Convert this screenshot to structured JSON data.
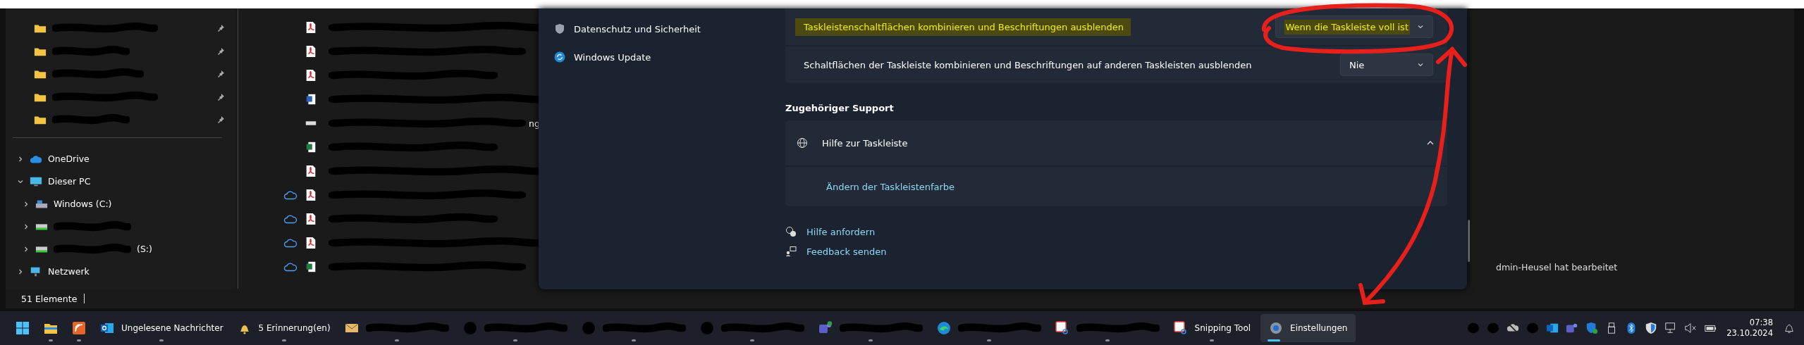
{
  "explorer": {
    "pinned": [
      {
        "kind": "folder",
        "redacted": true,
        "pinned": true
      },
      {
        "kind": "folder",
        "redacted": true,
        "pinned": true
      },
      {
        "kind": "folder",
        "redacted": true,
        "pinned": true
      },
      {
        "kind": "folder",
        "redacted": true,
        "pinned": true
      },
      {
        "kind": "folder",
        "redacted": true,
        "pinned": true
      }
    ],
    "tree": [
      {
        "label": "OneDrive",
        "kind": "cloud",
        "expanded": false
      },
      {
        "label": "Dieser PC",
        "kind": "pc",
        "expanded": true,
        "children": [
          {
            "label": "Windows  (C:)",
            "kind": "disk",
            "expanded": false,
            "redacted": false
          },
          {
            "kind": "drive",
            "expanded": false,
            "redacted": true
          },
          {
            "label": "(S:)",
            "kind": "drive",
            "expanded": false,
            "redacted": true
          }
        ]
      },
      {
        "label": "Netzwerk",
        "kind": "network",
        "expanded": false
      }
    ],
    "files": [
      {
        "kind": "pdf",
        "cloud": false,
        "redacted": true
      },
      {
        "kind": "pdf",
        "cloud": false,
        "redacted": true
      },
      {
        "kind": "pdf",
        "cloud": false,
        "redacted": true
      },
      {
        "kind": "word",
        "cloud": false,
        "redacted": true
      },
      {
        "kind": "image",
        "cloud": false,
        "redacted": true,
        "label": "ng"
      },
      {
        "kind": "excel",
        "cloud": false,
        "redacted": true
      },
      {
        "kind": "pdf",
        "cloud": false,
        "redacted": true
      },
      {
        "kind": "pdf",
        "cloud": true,
        "redacted": true
      },
      {
        "kind": "pdf",
        "cloud": true,
        "redacted": true
      },
      {
        "kind": "pdf",
        "cloud": true,
        "redacted": true
      },
      {
        "kind": "excel",
        "cloud": true,
        "redacted": true,
        "detail": "dmin-Heusel hat bearbeitet"
      }
    ],
    "status_bar": "51 Elemente"
  },
  "settings": {
    "sidebar": [
      {
        "label": "Datenschutz und Sicherheit",
        "kind": "shield"
      },
      {
        "label": "Windows Update",
        "kind": "update"
      }
    ],
    "options": [
      {
        "label": "Taskleistenschaltflächen kombinieren und Beschriftungen ausblenden",
        "highlighted": true,
        "value": "Wenn die Taskleiste voll ist",
        "value_highlighted": true
      },
      {
        "label": "Schaltflächen der Taskleiste kombinieren und Beschriftungen auf anderen Taskleisten ausblenden",
        "highlighted": false,
        "value": "Nie",
        "value_highlighted": false
      }
    ],
    "support": {
      "heading": "Zugehöriger Support",
      "title": "Hilfe zur Taskleiste",
      "expanded": true,
      "links": [
        "Ändern der Taskleistenfarbe"
      ]
    },
    "footer_links": [
      {
        "label": "Hilfe anfordern",
        "kind": "help"
      },
      {
        "label": "Feedback senden",
        "kind": "feedback"
      }
    ]
  },
  "taskbar": {
    "apps": [
      {
        "kind": "start",
        "running": false,
        "active": false
      },
      {
        "kind": "explorer",
        "running": true,
        "active": false
      },
      {
        "kind": "orange",
        "running": true,
        "active": false
      },
      {
        "kind": "outlook",
        "label": "Ungelesene Nachrichter",
        "running": true,
        "active": false
      },
      {
        "kind": "bell",
        "label": "5 Erinnerung(en)",
        "running": true,
        "active": false
      },
      {
        "kind": "mail",
        "redacted": true,
        "running": true,
        "active": false
      },
      {
        "kind": "redacted",
        "redacted": true,
        "running": true,
        "active": false
      },
      {
        "kind": "redacted",
        "redacted": true,
        "running": true,
        "active": false
      },
      {
        "kind": "redacted",
        "redacted": true,
        "running": true,
        "active": false
      },
      {
        "kind": "teams",
        "redacted": true,
        "running": true,
        "active": false
      },
      {
        "kind": "edge",
        "redacted": true,
        "running": true,
        "active": false
      },
      {
        "kind": "snip",
        "redacted": true,
        "running": true,
        "active": false
      },
      {
        "kind": "snip",
        "label": "Snipping Tool",
        "running": true,
        "active": false
      },
      {
        "kind": "settings",
        "label": "Einstellungen",
        "running": true,
        "active": true
      }
    ],
    "tray": [
      {
        "kind": "redacted"
      },
      {
        "kind": "redacted"
      },
      {
        "kind": "cloud-off"
      },
      {
        "kind": "redacted"
      },
      {
        "kind": "outlook"
      },
      {
        "kind": "teams"
      },
      {
        "kind": "shield-check"
      },
      {
        "kind": "usb"
      },
      {
        "kind": "bluetooth"
      },
      {
        "kind": "defender"
      },
      {
        "kind": "network"
      },
      {
        "kind": "mute"
      },
      {
        "kind": "battery"
      }
    ],
    "time": "07:38",
    "date": "23.10.2024"
  }
}
